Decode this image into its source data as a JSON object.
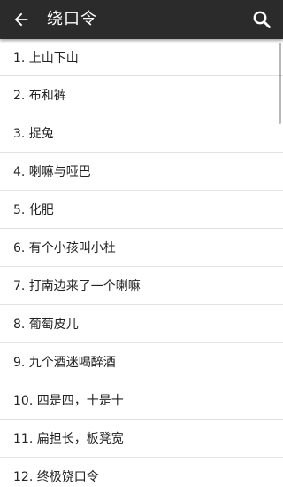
{
  "toolbar": {
    "title": "绕口令",
    "back_icon": "arrow-back-icon",
    "search_icon": "search-icon",
    "background": "#2b2b2b"
  },
  "items": [
    {
      "label": "1. 上山下山"
    },
    {
      "label": "2. 布和裤"
    },
    {
      "label": "3. 捉兔"
    },
    {
      "label": "4. 喇嘛与哑巴"
    },
    {
      "label": "5. 化肥"
    },
    {
      "label": "6. 有个小孩叫小杜"
    },
    {
      "label": "7. 打南边来了一个喇嘛"
    },
    {
      "label": "8. 葡萄皮儿"
    },
    {
      "label": "9. 九个酒迷喝醉酒"
    },
    {
      "label": "10. 四是四，十是十"
    },
    {
      "label": "11. 扁担长，板凳宽"
    },
    {
      "label": "12. 终极饶口令"
    }
  ]
}
